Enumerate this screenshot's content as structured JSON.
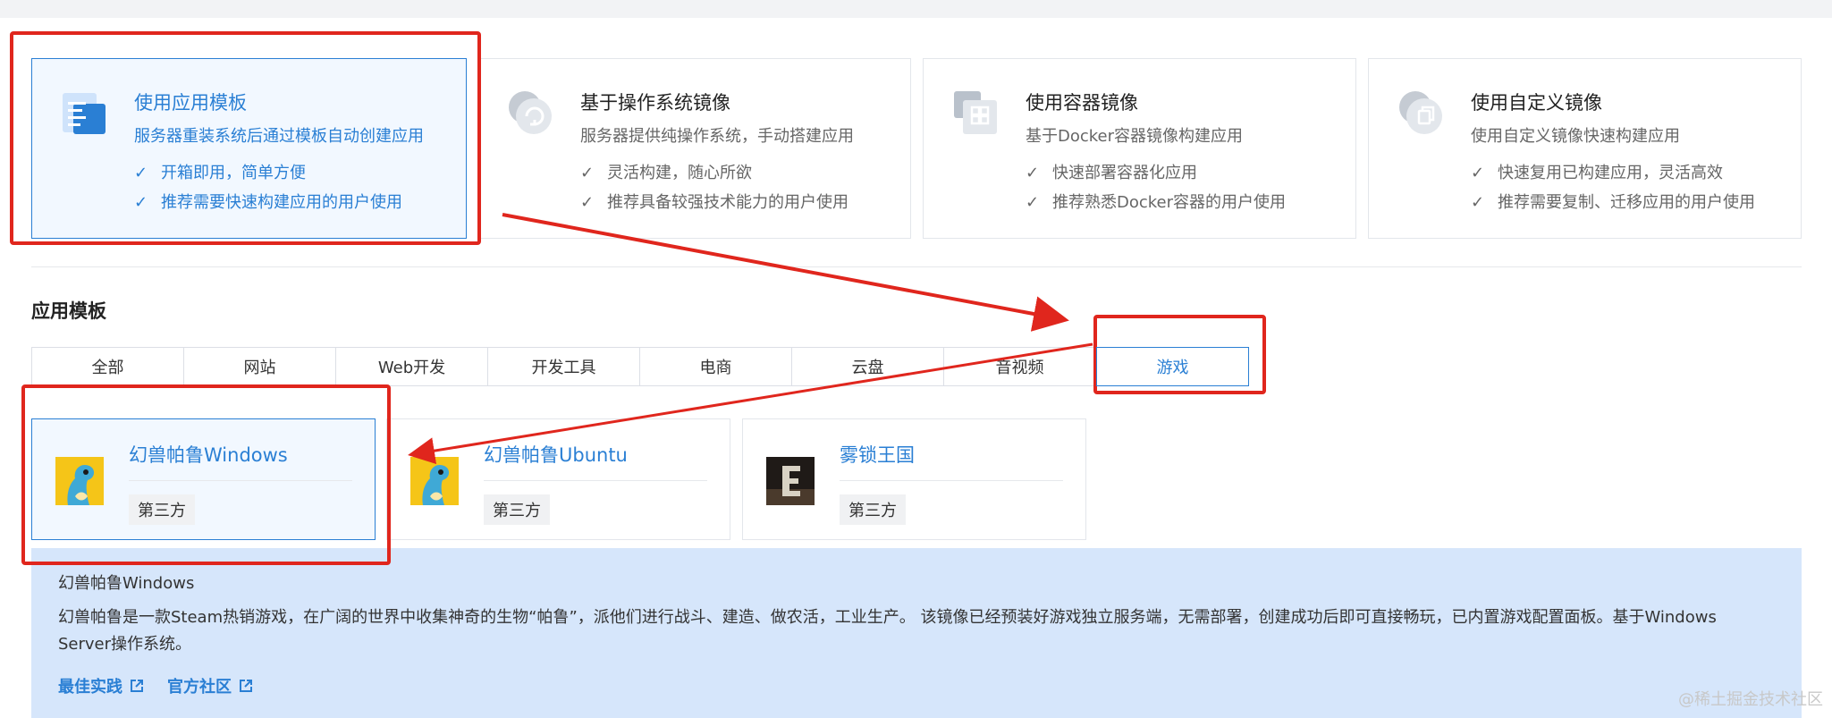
{
  "source_options": [
    {
      "title": "使用应用模板",
      "desc": "服务器重装系统后通过模板自动创建应用",
      "features": [
        "开箱即用，简单方便",
        "推荐需要快速构建应用的用户使用"
      ],
      "icon": "app-template-icon",
      "selected": true
    },
    {
      "title": "基于操作系统镜像",
      "desc": "服务器提供纯操作系统，手动搭建应用",
      "features": [
        "灵活构建，随心所欲",
        "推荐具备较强技术能力的用户使用"
      ],
      "icon": "os-image-icon",
      "selected": false
    },
    {
      "title": "使用容器镜像",
      "desc": "基于Docker容器镜像构建应用",
      "features": [
        "快速部署容器化应用",
        "推荐熟悉Docker容器的用户使用"
      ],
      "icon": "container-image-icon",
      "selected": false
    },
    {
      "title": "使用自定义镜像",
      "desc": "使用自定义镜像快速构建应用",
      "features": [
        "快速复用已构建应用，灵活高效",
        "推荐需要复制、迁移应用的用户使用"
      ],
      "icon": "custom-image-icon",
      "selected": false
    }
  ],
  "section_title": "应用模板",
  "tabs": [
    "全部",
    "网站",
    "Web开发",
    "开发工具",
    "电商",
    "云盘",
    "音视频",
    "游戏"
  ],
  "active_tab": "游戏",
  "games": [
    {
      "name": "幻兽帕鲁Windows",
      "tag": "第三方",
      "selected": true
    },
    {
      "name": "幻兽帕鲁Ubuntu",
      "tag": "第三方",
      "selected": false
    },
    {
      "name": "雾锁王国",
      "tag": "第三方",
      "selected": false
    }
  ],
  "info": {
    "title": "幻兽帕鲁Windows",
    "description": "幻兽帕鲁是一款Steam热销游戏，在广阔的世界中收集神奇的生物“帕鲁”，派他们进行战斗、建造、做农活，工业生产。 该镜像已经预装好游戏独立服务端，无需部署，创建成功后即可直接畅玩，已内置游戏配置面板。基于Windows Server操作系统。",
    "links": [
      "最佳实践",
      "官方社区"
    ]
  },
  "watermark": "@稀土掘金技术社区",
  "colors": {
    "accent": "#2a7fd4",
    "annotation": "#e0261d",
    "info_bg": "#d6e6fb"
  }
}
